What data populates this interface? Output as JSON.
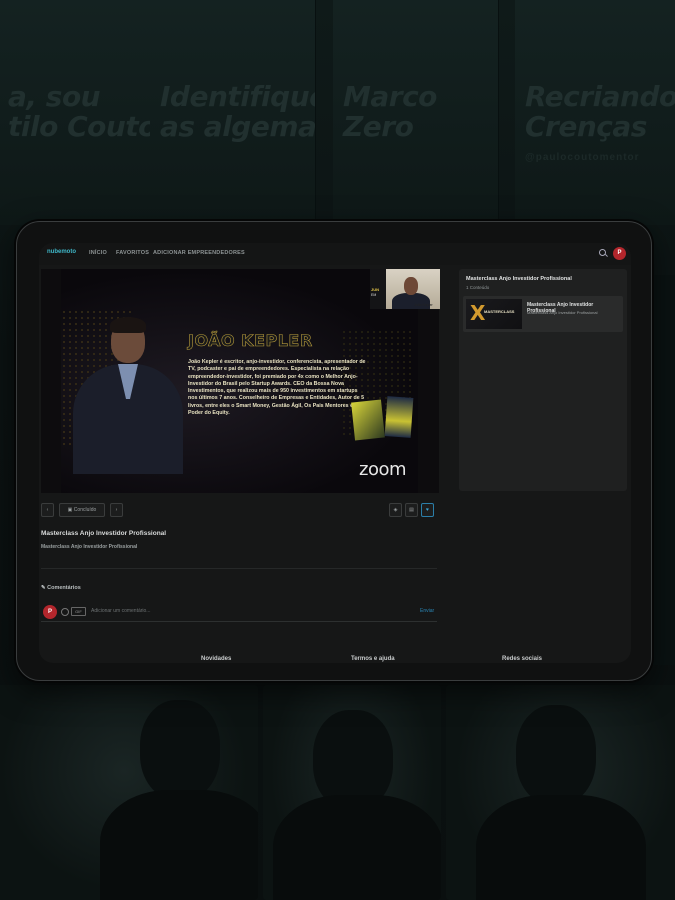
{
  "background": {
    "posters": [
      {
        "title": "a, sou\ntilo Couto",
        "subtitle": ""
      },
      {
        "title": "Identifique\nas algemas",
        "subtitle": ""
      },
      {
        "title": "Marco\nZero",
        "subtitle": ""
      },
      {
        "title": "Recriando\nCrenças",
        "subtitle": "@paulocoutomentor"
      }
    ]
  },
  "app": {
    "logo": "nubemoto",
    "nav": [
      "INÍCIO",
      "FAVORITOS",
      "ADICIONAR EMPREENDEDORES"
    ],
    "avatar_initial": "P",
    "accent_color": "#3aa6d8",
    "avatar_color": "#b3262c"
  },
  "video": {
    "slide_title": "JOÃO KEPLER",
    "slide_body": "João Kepler é escritor, anjo-investidor, conferencista, apresentador de TV, podcaster e pai de empreendedores. Especialista na relação empreendedor-investidor, foi premiado por 4x como o Melhor Anjo-Investidor do Brasil pelo Startup Awards. CEO da Bossa Nova Investimentos, que realizou mais de 950 investimentos em startups nos últimos 7 anos. Conselheiro de Empresas e Entidades, Autor de 5 livros, entre eles o Smart Money, Gestão Ágil, Os Pais Mentores e O Poder do Equity.",
    "watermark": "zoom",
    "pip_label_1": "JUN",
    "pip_label_2": "EM",
    "pip_label_3": "João Kepler"
  },
  "controls": {
    "prev": "‹",
    "done_label": "Concluído",
    "next": "›"
  },
  "lesson": {
    "title": "Masterclass Anjo Investidor Profissional",
    "subtitle": "Masterclass Anjo Investidor Profissional"
  },
  "comments": {
    "header": "Comentários",
    "avatar_initial": "P",
    "gif_label": "GIF",
    "placeholder": "Adicionar um comentário...",
    "send_label": "Enviar"
  },
  "sidebar": {
    "title": "Masterclass Anjo Investidor Profissional",
    "subtitle": "1 Conteúdo",
    "item": {
      "title": "Masterclass Anjo Investidor Profissional",
      "subtitle": "Masterclass Anjo Investidor Profissional",
      "thumb_glyph": "X",
      "thumb_text": "MASTERCLASS"
    }
  },
  "footer": [
    "Novidades",
    "Termos e ajuda",
    "Redes sociais"
  ]
}
